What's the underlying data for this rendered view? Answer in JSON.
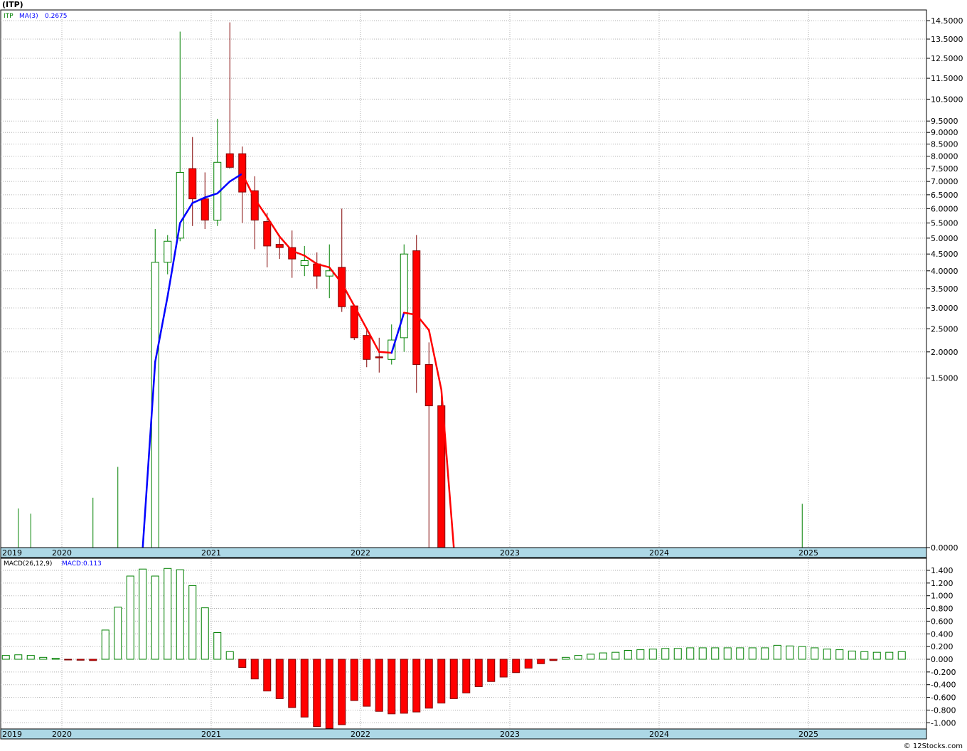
{
  "title": "(ITP)",
  "watermark": "© 12Stocks.com",
  "price_panel": {
    "legend": {
      "symbol": "ITP",
      "ma_label": "MA(3)",
      "ma_value": "0.2675"
    }
  },
  "macd_panel": {
    "legend": {
      "label": "MACD(26,12,9)",
      "value_label": "MACD:0.113"
    }
  },
  "colors": {
    "up": "#008000",
    "down": "#ff0000",
    "ma_up": "#0000ff",
    "ma_down": "#ff0000",
    "grid": "#b0b0b0",
    "time_axis_bg": "#add8e6"
  },
  "chart_data": [
    {
      "type": "candlestick",
      "name": "price",
      "y_ticks": [
        "14.5000",
        "13.5000",
        "12.5000",
        "11.5000",
        "10.5000",
        "9.5000",
        "9.0000",
        "8.5000",
        "8.0000",
        "7.5000",
        "7.0000",
        "6.5000",
        "6.0000",
        "5.5000",
        "5.0000",
        "4.5000",
        "4.0000",
        "3.5000",
        "3.0000",
        "2.5000",
        "2.0000",
        "1.5000",
        "0.0000"
      ],
      "x_tick_labels": [
        "2019",
        "2020",
        "2021",
        "2022",
        "2023",
        "2024",
        "2025"
      ],
      "candles": [
        {
          "date": "2019-09",
          "open": 0.0,
          "high": 0.08,
          "low": 0.0,
          "close": 0.0
        },
        {
          "date": "2019-10",
          "open": 0.0,
          "high": 0.06,
          "low": 0.0,
          "close": 0.0
        },
        {
          "date": "2020-03",
          "open": 0.0,
          "high": 0.13,
          "low": 0.0,
          "close": 0.0
        },
        {
          "date": "2020-05",
          "open": 0.0,
          "high": 0.34,
          "low": 0.0,
          "close": 0.0
        },
        {
          "date": "2020-08",
          "open": 0.0,
          "high": 5.3,
          "low": 0.0,
          "close": 4.25
        },
        {
          "date": "2020-09",
          "open": 4.25,
          "high": 5.1,
          "low": 3.9,
          "close": 4.9
        },
        {
          "date": "2020-10",
          "open": 5.0,
          "high": 13.9,
          "low": 4.9,
          "close": 7.35
        },
        {
          "date": "2020-11",
          "open": 7.5,
          "high": 8.8,
          "low": 5.4,
          "close": 6.35
        },
        {
          "date": "2020-12",
          "open": 6.35,
          "high": 7.35,
          "low": 5.3,
          "close": 5.6
        },
        {
          "date": "2021-01",
          "open": 5.6,
          "high": 9.6,
          "low": 5.4,
          "close": 7.75
        },
        {
          "date": "2021-02",
          "open": 8.1,
          "high": 14.4,
          "low": 7.5,
          "close": 7.55
        },
        {
          "date": "2021-03",
          "open": 8.1,
          "high": 8.4,
          "low": 5.5,
          "close": 6.6
        },
        {
          "date": "2021-04",
          "open": 6.65,
          "high": 7.2,
          "low": 4.65,
          "close": 5.6
        },
        {
          "date": "2021-05",
          "open": 5.55,
          "high": 5.85,
          "low": 4.1,
          "close": 4.75
        },
        {
          "date": "2021-06",
          "open": 4.8,
          "high": 5.1,
          "low": 4.35,
          "close": 4.7
        },
        {
          "date": "2021-07",
          "open": 4.7,
          "high": 5.25,
          "low": 3.8,
          "close": 4.35
        },
        {
          "date": "2021-08",
          "open": 4.15,
          "high": 4.75,
          "low": 3.85,
          "close": 4.3
        },
        {
          "date": "2021-09",
          "open": 4.2,
          "high": 4.55,
          "low": 3.5,
          "close": 3.85
        },
        {
          "date": "2021-10",
          "open": 3.85,
          "high": 4.8,
          "low": 3.25,
          "close": 4.0
        },
        {
          "date": "2021-11",
          "open": 4.1,
          "high": 6.0,
          "low": 2.9,
          "close": 3.03
        },
        {
          "date": "2021-12",
          "open": 3.05,
          "high": 3.05,
          "low": 2.25,
          "close": 2.3
        },
        {
          "date": "2022-01",
          "open": 2.35,
          "high": 2.5,
          "low": 1.7,
          "close": 1.85
        },
        {
          "date": "2022-02",
          "open": 1.9,
          "high": 2.3,
          "low": 1.6,
          "close": 1.88
        },
        {
          "date": "2022-03",
          "open": 1.85,
          "high": 2.6,
          "low": 1.75,
          "close": 2.25
        },
        {
          "date": "2022-04",
          "open": 2.3,
          "high": 4.8,
          "low": 2.0,
          "close": 4.5
        },
        {
          "date": "2022-05",
          "open": 4.6,
          "high": 5.1,
          "low": 1.25,
          "close": 1.75
        },
        {
          "date": "2022-06",
          "open": 1.75,
          "high": 2.2,
          "low": 0.0,
          "close": 1.05
        },
        {
          "date": "2022-07",
          "open": 1.05,
          "high": 1.2,
          "low": 0.0,
          "close": 0.0
        },
        {
          "date": "2022-08",
          "open": 0.0,
          "high": 0.0,
          "low": 0.0,
          "close": 0.0
        },
        {
          "date": "2024-12",
          "open": 0.0,
          "high": 0.1,
          "low": 0.0,
          "close": 0.0
        }
      ],
      "ma3": [
        {
          "date": "2020-07",
          "value": 0.0
        },
        {
          "date": "2020-08",
          "value": 1.8
        },
        {
          "date": "2020-09",
          "value": 3.3
        },
        {
          "date": "2020-10",
          "value": 5.5
        },
        {
          "date": "2020-11",
          "value": 6.2
        },
        {
          "date": "2020-12",
          "value": 6.4
        },
        {
          "date": "2021-01",
          "value": 6.55
        },
        {
          "date": "2021-02",
          "value": 7.0
        },
        {
          "date": "2021-03",
          "value": 7.3
        },
        {
          "date": "2021-04",
          "value": 6.35
        },
        {
          "date": "2021-05",
          "value": 5.7
        },
        {
          "date": "2021-06",
          "value": 5.05
        },
        {
          "date": "2021-07",
          "value": 4.6
        },
        {
          "date": "2021-08",
          "value": 4.45
        },
        {
          "date": "2021-09",
          "value": 4.2
        },
        {
          "date": "2021-10",
          "value": 4.1
        },
        {
          "date": "2021-11",
          "value": 3.65
        },
        {
          "date": "2021-12",
          "value": 3.05
        },
        {
          "date": "2022-01",
          "value": 2.5
        },
        {
          "date": "2022-02",
          "value": 2.0
        },
        {
          "date": "2022-03",
          "value": 1.98
        },
        {
          "date": "2022-04",
          "value": 2.88
        },
        {
          "date": "2022-05",
          "value": 2.83
        },
        {
          "date": "2022-06",
          "value": 2.47
        },
        {
          "date": "2022-07",
          "value": 1.3
        },
        {
          "date": "2022-08",
          "value": 0.0
        }
      ]
    },
    {
      "type": "bar",
      "name": "macd",
      "y_ticks": [
        "1.400",
        "1.200",
        "1.000",
        "0.800",
        "0.600",
        "0.400",
        "0.200",
        "0.000",
        "-0.200",
        "-0.400",
        "-0.600",
        "-0.800",
        "-1.000"
      ],
      "ylim": [
        -1.1,
        1.5
      ],
      "x_tick_labels": [
        "2019",
        "2020",
        "2021",
        "2022",
        "2023",
        "2024",
        "2025"
      ],
      "bars": [
        {
          "date": "2019-05",
          "value": 0.005
        },
        {
          "date": "2019-06",
          "value": 0.005
        },
        {
          "date": "2019-07",
          "value": 0.04
        },
        {
          "date": "2019-08",
          "value": 0.06
        },
        {
          "date": "2019-09",
          "value": 0.07
        },
        {
          "date": "2019-10",
          "value": 0.06
        },
        {
          "date": "2019-11",
          "value": 0.03
        },
        {
          "date": "2019-12",
          "value": 0.015
        },
        {
          "date": "2020-01",
          "value": -0.01
        },
        {
          "date": "2020-02",
          "value": -0.015
        },
        {
          "date": "2020-03",
          "value": -0.02
        },
        {
          "date": "2020-04",
          "value": 0.46
        },
        {
          "date": "2020-05",
          "value": 0.82
        },
        {
          "date": "2020-06",
          "value": 1.31
        },
        {
          "date": "2020-07",
          "value": 1.42
        },
        {
          "date": "2020-08",
          "value": 1.31
        },
        {
          "date": "2020-09",
          "value": 1.43
        },
        {
          "date": "2020-10",
          "value": 1.41
        },
        {
          "date": "2020-11",
          "value": 1.16
        },
        {
          "date": "2020-12",
          "value": 0.81
        },
        {
          "date": "2021-01",
          "value": 0.42
        },
        {
          "date": "2021-02",
          "value": 0.12
        },
        {
          "date": "2021-03",
          "value": -0.13
        },
        {
          "date": "2021-04",
          "value": -0.31
        },
        {
          "date": "2021-05",
          "value": -0.5
        },
        {
          "date": "2021-06",
          "value": -0.62
        },
        {
          "date": "2021-07",
          "value": -0.76
        },
        {
          "date": "2021-08",
          "value": -0.91
        },
        {
          "date": "2021-09",
          "value": -1.06
        },
        {
          "date": "2021-10",
          "value": -1.09
        },
        {
          "date": "2021-11",
          "value": -1.03
        },
        {
          "date": "2021-12",
          "value": -0.65
        },
        {
          "date": "2022-01",
          "value": -0.74
        },
        {
          "date": "2022-02",
          "value": -0.82
        },
        {
          "date": "2022-03",
          "value": -0.86
        },
        {
          "date": "2022-04",
          "value": -0.85
        },
        {
          "date": "2022-05",
          "value": -0.83
        },
        {
          "date": "2022-06",
          "value": -0.77
        },
        {
          "date": "2022-07",
          "value": -0.69
        },
        {
          "date": "2022-08",
          "value": -0.62
        },
        {
          "date": "2022-09",
          "value": -0.53
        },
        {
          "date": "2022-10",
          "value": -0.43
        },
        {
          "date": "2022-11",
          "value": -0.35
        },
        {
          "date": "2022-12",
          "value": -0.28
        },
        {
          "date": "2023-01",
          "value": -0.21
        },
        {
          "date": "2023-02",
          "value": -0.14
        },
        {
          "date": "2023-03",
          "value": -0.07
        },
        {
          "date": "2023-04",
          "value": -0.02
        },
        {
          "date": "2023-05",
          "value": 0.03
        },
        {
          "date": "2023-06",
          "value": 0.06
        },
        {
          "date": "2023-07",
          "value": 0.08
        },
        {
          "date": "2023-08",
          "value": 0.1
        },
        {
          "date": "2023-09",
          "value": 0.11
        },
        {
          "date": "2023-10",
          "value": 0.14
        },
        {
          "date": "2023-11",
          "value": 0.15
        },
        {
          "date": "2023-12",
          "value": 0.16
        },
        {
          "date": "2024-01",
          "value": 0.17
        },
        {
          "date": "2024-02",
          "value": 0.17
        },
        {
          "date": "2024-03",
          "value": 0.18
        },
        {
          "date": "2024-04",
          "value": 0.18
        },
        {
          "date": "2024-05",
          "value": 0.18
        },
        {
          "date": "2024-06",
          "value": 0.18
        },
        {
          "date": "2024-07",
          "value": 0.18
        },
        {
          "date": "2024-08",
          "value": 0.18
        },
        {
          "date": "2024-09",
          "value": 0.18
        },
        {
          "date": "2024-10",
          "value": 0.22
        },
        {
          "date": "2024-11",
          "value": 0.21
        },
        {
          "date": "2024-12",
          "value": 0.2
        },
        {
          "date": "2025-01",
          "value": 0.18
        },
        {
          "date": "2025-02",
          "value": 0.16
        },
        {
          "date": "2025-03",
          "value": 0.15
        },
        {
          "date": "2025-04",
          "value": 0.13
        },
        {
          "date": "2025-05",
          "value": 0.12
        },
        {
          "date": "2025-06",
          "value": 0.11
        },
        {
          "date": "2025-07",
          "value": 0.11
        },
        {
          "date": "2025-08",
          "value": 0.12
        }
      ]
    }
  ]
}
